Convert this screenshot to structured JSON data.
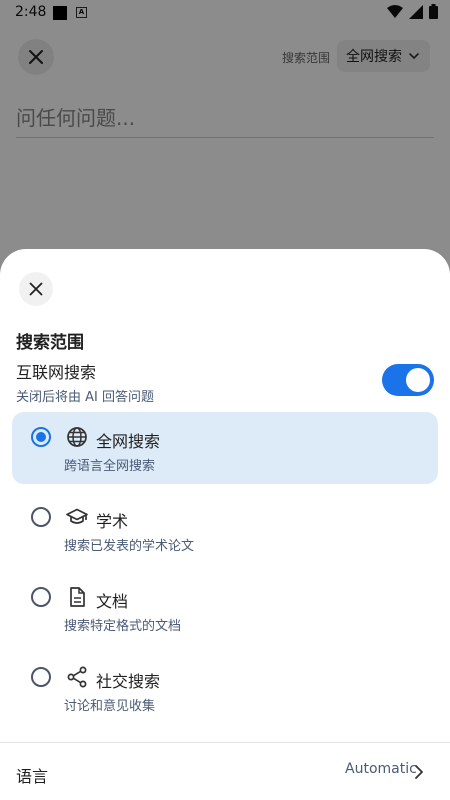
{
  "status_bar": {
    "time": "2:48",
    "badge": "A"
  },
  "background": {
    "scope_label": "搜索范围",
    "scope_value": "全网搜索",
    "query_placeholder": "问任何问题..."
  },
  "sheet": {
    "title": "搜索范围",
    "internet_search": {
      "label": "互联网搜索",
      "description": "关闭后将由 AI 回答问题",
      "enabled": true
    },
    "options": [
      {
        "label": "全网搜索",
        "description": "跨语言全网搜索",
        "icon": "globe-icon",
        "selected": true
      },
      {
        "label": "学术",
        "description": "搜索已发表的学术论文",
        "icon": "graduation-cap-icon",
        "selected": false
      },
      {
        "label": "文档",
        "description": "搜索特定格式的文档",
        "icon": "document-icon",
        "selected": false
      },
      {
        "label": "社交搜索",
        "description": "讨论和意见收集",
        "icon": "share-icon",
        "selected": false
      }
    ],
    "language": {
      "label": "语言",
      "value": "Automatic"
    }
  },
  "colors": {
    "accent": "#1a73e8",
    "selected_bg": "#ddebf8",
    "secondary_text": "#4a5b75"
  }
}
